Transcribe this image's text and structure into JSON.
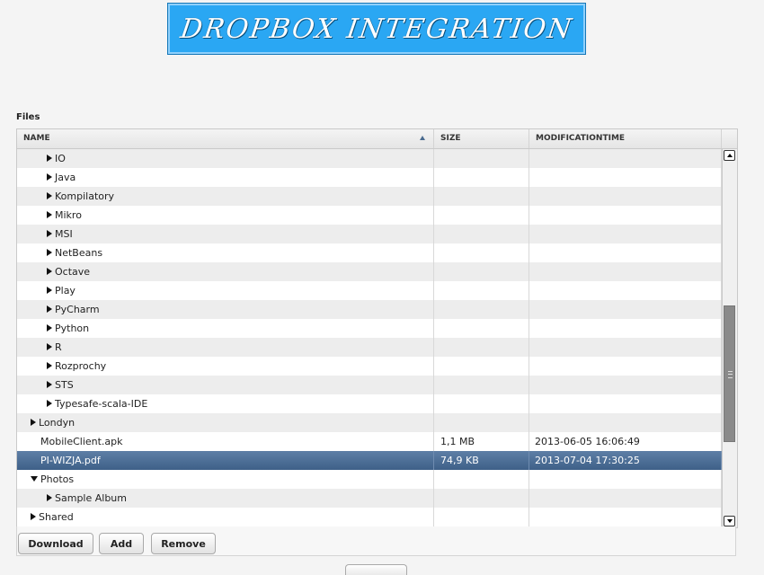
{
  "banner": {
    "title": "DROPBOX INTEGRATION"
  },
  "files_label": "Files",
  "table": {
    "columns": [
      "NAME",
      "SIZE",
      "MODIFICATIONTIME"
    ],
    "sort": {
      "column": "NAME",
      "direction": "ascending"
    },
    "rows": [
      {
        "name": "IO",
        "level": 2,
        "expander": "collapsed",
        "size": "",
        "time": ""
      },
      {
        "name": "Java",
        "level": 2,
        "expander": "collapsed",
        "size": "",
        "time": ""
      },
      {
        "name": "Kompilatory",
        "level": 2,
        "expander": "collapsed",
        "size": "",
        "time": ""
      },
      {
        "name": "Mikro",
        "level": 2,
        "expander": "collapsed",
        "size": "",
        "time": ""
      },
      {
        "name": "MSI",
        "level": 2,
        "expander": "collapsed",
        "size": "",
        "time": ""
      },
      {
        "name": "NetBeans",
        "level": 2,
        "expander": "collapsed",
        "size": "",
        "time": ""
      },
      {
        "name": "Octave",
        "level": 2,
        "expander": "collapsed",
        "size": "",
        "time": ""
      },
      {
        "name": "Play",
        "level": 2,
        "expander": "collapsed",
        "size": "",
        "time": ""
      },
      {
        "name": "PyCharm",
        "level": 2,
        "expander": "collapsed",
        "size": "",
        "time": ""
      },
      {
        "name": "Python",
        "level": 2,
        "expander": "collapsed",
        "size": "",
        "time": ""
      },
      {
        "name": "R",
        "level": 2,
        "expander": "collapsed",
        "size": "",
        "time": ""
      },
      {
        "name": "Rozprochy",
        "level": 2,
        "expander": "collapsed",
        "size": "",
        "time": ""
      },
      {
        "name": "STS",
        "level": 2,
        "expander": "collapsed",
        "size": "",
        "time": ""
      },
      {
        "name": "Typesafe-scala-IDE",
        "level": 2,
        "expander": "collapsed",
        "size": "",
        "time": ""
      },
      {
        "name": "Londyn",
        "level": 1,
        "expander": "collapsed",
        "size": "",
        "time": ""
      },
      {
        "name": "MobileClient.apk",
        "level": 1,
        "expander": "none",
        "size": "1,1 MB",
        "time": "2013-06-05 16:06:49"
      },
      {
        "name": "PI-WIZJA.pdf",
        "level": 1,
        "expander": "none",
        "size": "74,9 KB",
        "time": "2013-07-04 17:30:25",
        "selected": true
      },
      {
        "name": "Photos",
        "level": 1,
        "expander": "expanded",
        "size": "",
        "time": ""
      },
      {
        "name": "Sample Album",
        "level": 2,
        "expander": "collapsed",
        "size": "",
        "time": ""
      },
      {
        "name": "Shared",
        "level": 1,
        "expander": "collapsed",
        "size": "",
        "time": ""
      }
    ]
  },
  "scrollbar": {
    "position_fraction": 0.55
  },
  "buttons": {
    "download": "Download",
    "add": "Add",
    "remove": "Remove"
  },
  "colors": {
    "banner": "#2aa7f3",
    "selected_row": "#4a6c94"
  },
  "icons": [
    "sort-ascending-icon",
    "expand-arrow-icon",
    "collapse-arrow-icon",
    "scroll-up-icon",
    "scroll-down-icon"
  ]
}
